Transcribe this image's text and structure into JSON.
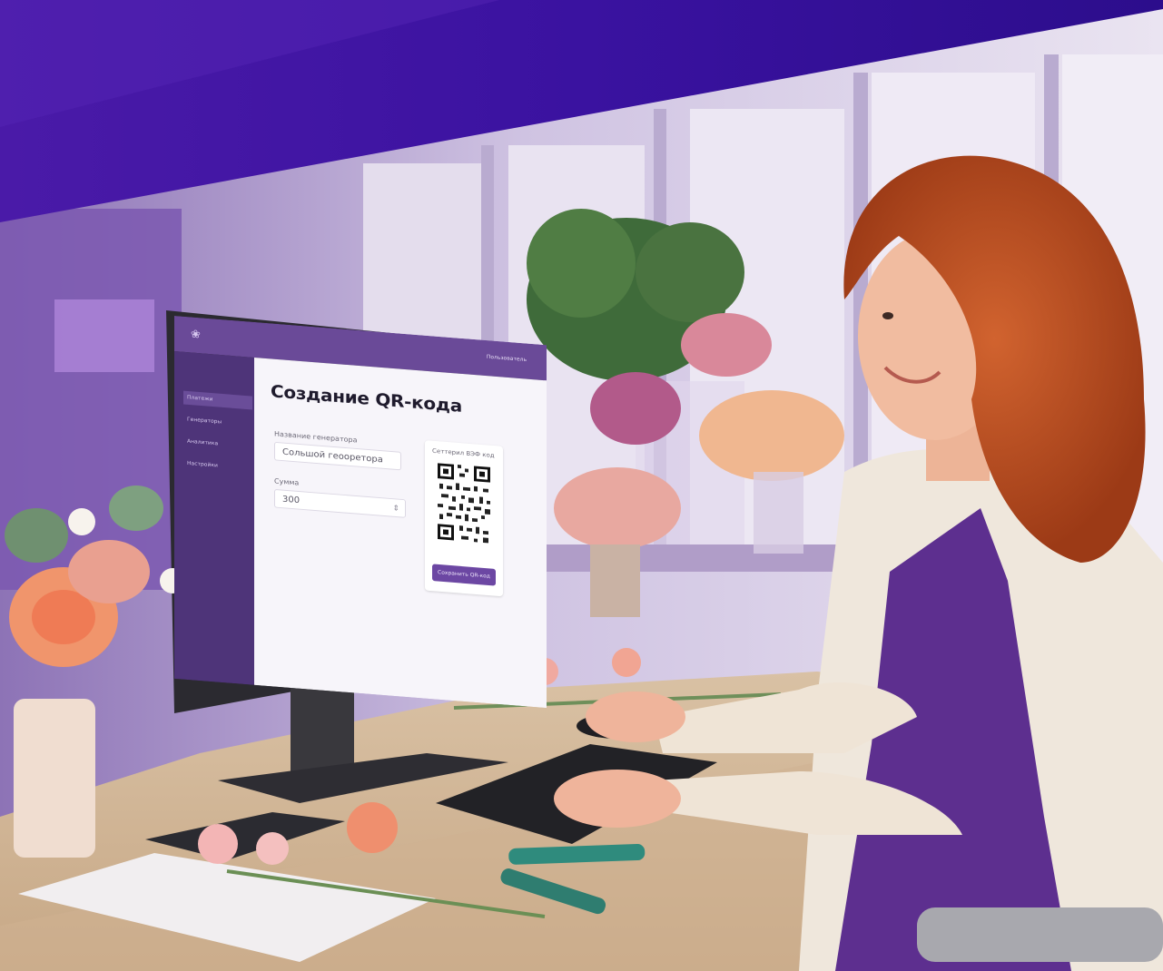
{
  "photo": {
    "subject": "person-at-computer"
  },
  "screen": {
    "logo_icon": "flower-icon",
    "user_label": "Пользователь",
    "sidebar": [
      {
        "label": "Платежи",
        "active": true
      },
      {
        "label": "Генераторы",
        "active": false
      },
      {
        "label": "Аналитика",
        "active": false
      },
      {
        "label": "Настройки",
        "active": false
      }
    ],
    "page_title": "Создание QR-кода",
    "generator_name_label": "Название генератора",
    "generator_name_value": "Сольшой геооретора",
    "amount_label": "Сумма",
    "amount_value": "300",
    "qr_label": "Сеттерил ВЭФ код",
    "qr_button": "Сохранить QR-код"
  },
  "colors": {
    "banner": "#3f14a6",
    "accent": "#6c47a3",
    "sidebar": "#4e3479"
  }
}
